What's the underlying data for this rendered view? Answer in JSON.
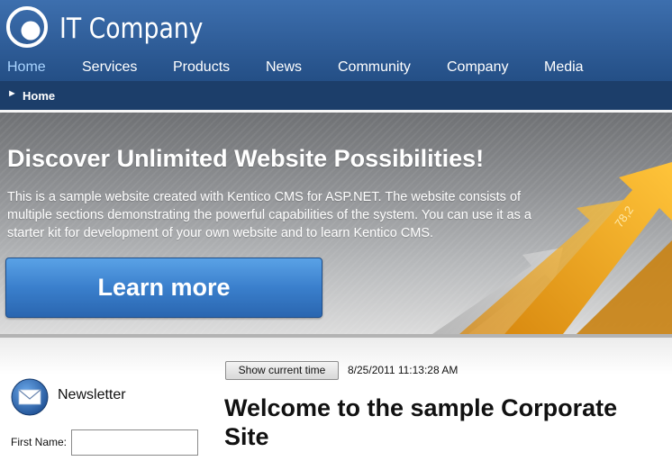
{
  "header": {
    "brand": "IT Company",
    "nav": [
      {
        "label": "Home",
        "active": true
      },
      {
        "label": "Services"
      },
      {
        "label": "Products"
      },
      {
        "label": "News"
      },
      {
        "label": "Community"
      },
      {
        "label": "Company"
      },
      {
        "label": "Media"
      }
    ]
  },
  "breadcrumb": {
    "label": "Home"
  },
  "banner": {
    "title": "Discover Unlimited Website Possibilities!",
    "text": "This is a sample website created with Kentico CMS for ASP.NET. The website consists of multiple sections demonstrating the powerful capabilities of the system. You can use it as a starter kit for development of your own website and to learn Kentico CMS.",
    "button": "Learn more",
    "art_label": "78,2"
  },
  "newsletter": {
    "title": "Newsletter",
    "first_name_label": "First Name:",
    "first_name_value": ""
  },
  "main": {
    "time_button": "Show current time",
    "time_value": "8/25/2011 11:13:28 AM",
    "welcome": "Welcome to the sample Corporate Site"
  },
  "colors": {
    "header": "#2f5d98",
    "breadcrumb_bar": "#1c3e6a",
    "active_nav": "#a9d4ff",
    "button": "#3a7fcc",
    "arrows": "#f0a020"
  }
}
